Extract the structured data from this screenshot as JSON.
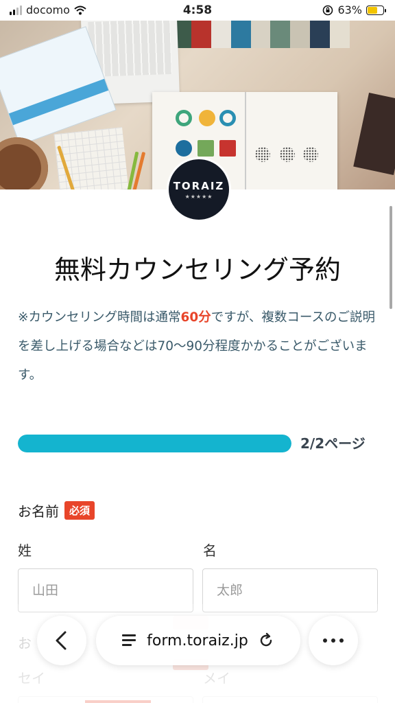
{
  "status_bar": {
    "carrier": "docomo",
    "time": "4:58",
    "battery_percent": "63%",
    "battery_level": 0.63,
    "battery_color": "#f2c400"
  },
  "brand": {
    "name": "TORAIZ",
    "stars": "★★★★★"
  },
  "page": {
    "title": "無料カウンセリング予約",
    "notice_before": "※カウンセリング時間は通常",
    "notice_highlight": "60分",
    "notice_after": "ですが、複数コースのご説明を差し上げる場合などは70～90分程度かかることがございます。"
  },
  "progress": {
    "label": "2/2ページ",
    "fraction": 1.0,
    "color": "#14b4cf"
  },
  "form": {
    "name_label": "お名前",
    "required": "必須",
    "last_name_label": "姓",
    "first_name_label": "名",
    "last_name_placeholder": "山田",
    "first_name_placeholder": "太郎",
    "kana_label_partial": "お",
    "sei_label": "セイ",
    "mei_label": "メイ"
  },
  "browser": {
    "url": "form.toraiz.jp",
    "back_icon": "chevron-left-icon",
    "more_icon": "more-icon"
  },
  "colors": {
    "accent_red": "#e8452a",
    "accent_teal": "#14b4cf"
  }
}
